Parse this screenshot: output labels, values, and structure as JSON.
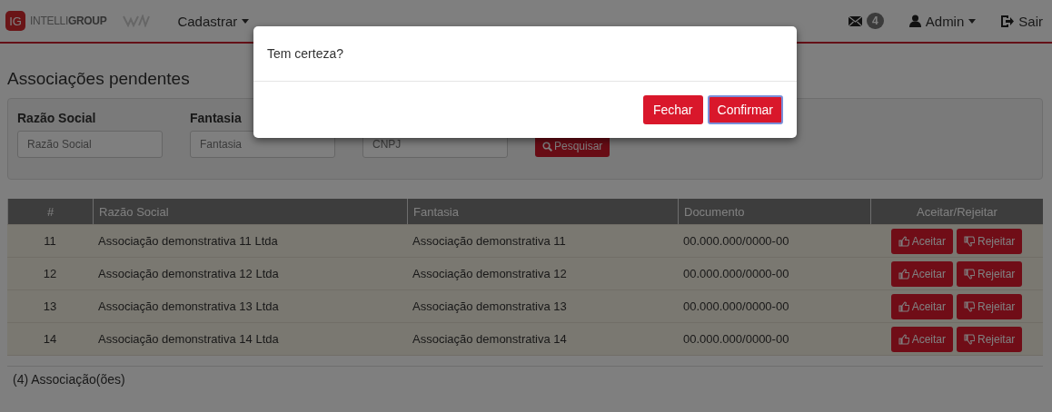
{
  "navbar": {
    "logo_mark": "IG",
    "logo_text": "INTELLI**GROUP**",
    "menu": "Cadastrar",
    "messages_count": "4",
    "user": "Admin",
    "logout": "Sair"
  },
  "page_title": "Associações pendentes",
  "filters": [
    {
      "label": "Razão Social",
      "placeholder": "Razão Social"
    },
    {
      "label": "Fantasia",
      "placeholder": "Fantasia"
    },
    {
      "placeholder": "CNPJ"
    }
  ],
  "search_button": "Pesquisar",
  "table": {
    "columns": [
      "#",
      "Razão Social",
      "Fantasia",
      "Documento",
      "Aceitar/Rejeitar"
    ],
    "rows": [
      {
        "id": "11",
        "name": "Associação demonstrativa 11 Ltda",
        "fantasy": "Associação demonstrativa 11",
        "document": "00.000.000/0000-00",
        "accept": "Aceitar",
        "reject": "Rejeitar"
      },
      {
        "id": "12",
        "name": "Associação demonstrativa 12 Ltda",
        "fantasy": "Associação demonstrativa 12",
        "document": "00.000.000/0000-00",
        "accept": "Aceitar",
        "reject": "Rejeitar"
      },
      {
        "id": "13",
        "name": "Associação demonstrativa 13 Ltda",
        "fantasy": "Associação demonstrativa 13",
        "document": "00.000.000/0000-00",
        "accept": "Aceitar",
        "reject": "Rejeitar"
      },
      {
        "id": "14",
        "name": "Associação demonstrativa 14 Ltda",
        "fantasy": "Associação demonstrativa 14",
        "document": "00.000.000/0000-00",
        "accept": "Aceitar",
        "reject": "Rejeitar"
      }
    ]
  },
  "footer_count": "(4) Associação(ões)",
  "modal": {
    "message": "Tem certeza?",
    "buttons": [
      {
        "label": "Fechar",
        "selected": false
      },
      {
        "label": "Confirmar",
        "selected": true
      }
    ]
  }
}
